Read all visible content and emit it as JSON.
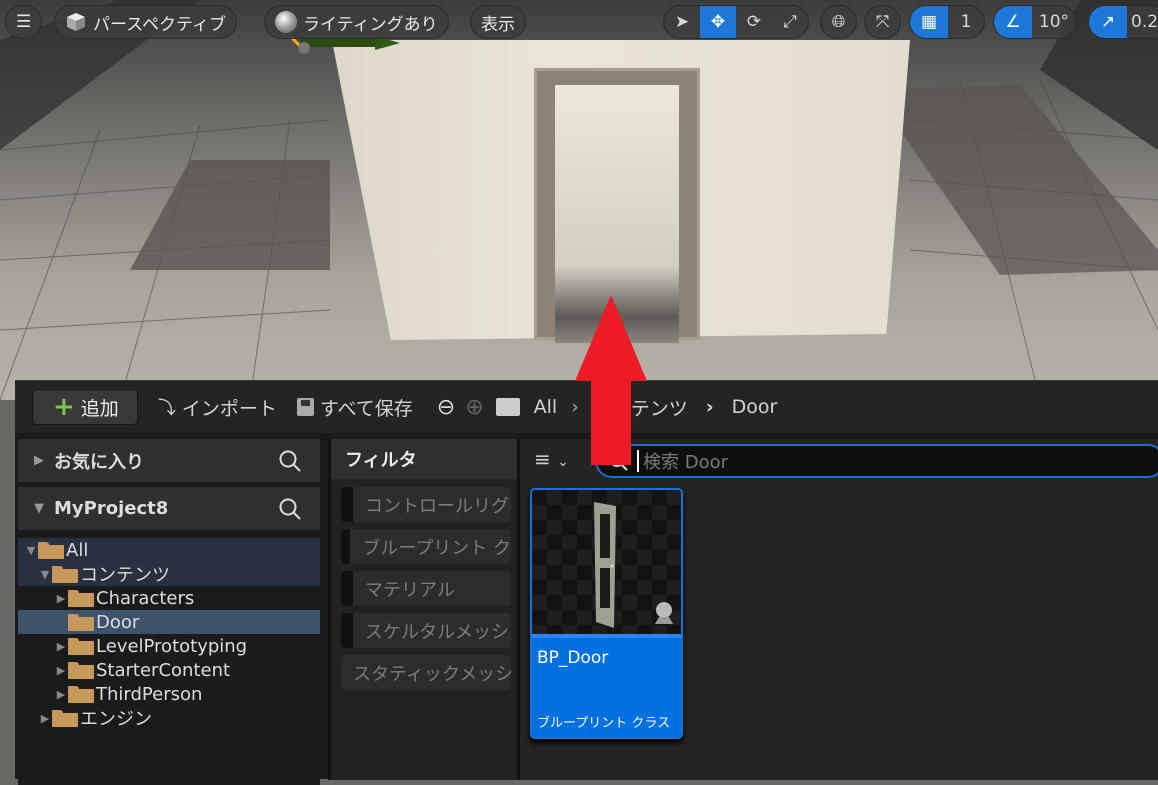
{
  "viewport": {
    "menu_icon": "hamburger-icon",
    "perspective_label": "パースペクティブ",
    "lighting_label": "ライティングあり",
    "show_label": "表示",
    "transform_tools": [
      "select",
      "translate",
      "rotate",
      "scale"
    ],
    "active_tool": "translate",
    "grid_snap_value": "1",
    "rotation_snap_value": "10°",
    "scale_snap_value": "0.2"
  },
  "toolbar": {
    "add_label": "追加",
    "import_label": "インポート",
    "save_all_label": "すべて保存",
    "breadcrumb": [
      "All",
      "コンテンツ",
      "Door"
    ]
  },
  "favorites": {
    "label": "お気に入り"
  },
  "project": {
    "label": "MyProject8"
  },
  "tree": [
    {
      "label": "All",
      "depth": 0,
      "expanded": true,
      "open": true
    },
    {
      "label": "コンテンツ",
      "depth": 1,
      "expanded": true,
      "open": true
    },
    {
      "label": "Characters",
      "depth": 2,
      "expanded": false
    },
    {
      "label": "Door",
      "depth": 2,
      "selected": true,
      "leaf": true
    },
    {
      "label": "LevelPrototyping",
      "depth": 2,
      "expanded": false
    },
    {
      "label": "StarterContent",
      "depth": 2,
      "expanded": false
    },
    {
      "label": "ThirdPerson",
      "depth": 2,
      "expanded": false
    },
    {
      "label": "エンジン",
      "depth": 1,
      "expanded": false
    }
  ],
  "filters": {
    "title": "フィルタ",
    "items": [
      "コントロールリグ",
      "ブループリント ク",
      "マテリアル",
      "スケルタルメッシ",
      "スタティックメッシ"
    ]
  },
  "search": {
    "placeholder": "検索 Door"
  },
  "assets": [
    {
      "name": "BP_Door",
      "type": "ブループリント クラス"
    }
  ],
  "colors": {
    "accent": "#0070e0",
    "folder": "#c7975b",
    "annotation_arrow": "#ee1c25"
  }
}
